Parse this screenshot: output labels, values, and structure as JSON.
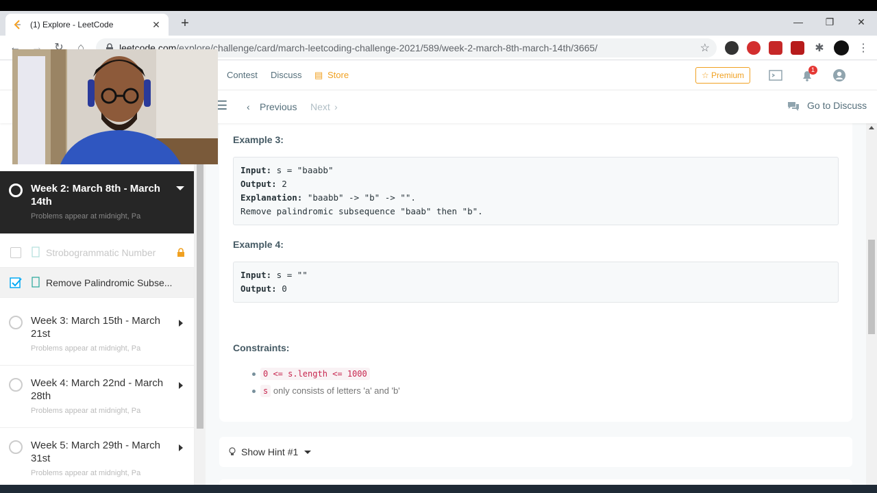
{
  "browser": {
    "tab_title": "(1) Explore - LeetCode",
    "tab_close": "✕",
    "new_tab": "+",
    "url_host": "leetcode.com",
    "url_path": "/explore/challenge/card/march-leetcoding-challenge-2021/589/week-2-march-8th-march-14th/3665/",
    "min": "—",
    "restore": "❐",
    "close": "✕"
  },
  "header": {
    "nav": [
      "Contest",
      "Discuss",
      "Store"
    ],
    "premium": "Premium",
    "notification_count": "1"
  },
  "subbar": {
    "previous": "Previous",
    "next": "Next",
    "discuss": "Go to Discuss"
  },
  "sidebar": {
    "active_week": {
      "title": "Week 2: March 8th - March 14th",
      "subtitle": "Problems appear at midnight, Pa"
    },
    "problems": [
      {
        "label": "Strobogrammatic Number",
        "locked": true,
        "checked": false
      },
      {
        "label": "Remove Palindromic Subse...",
        "locked": false,
        "checked": true
      }
    ],
    "weeks": [
      {
        "title": "Week 3: March 15th - March 21st",
        "subtitle": "Problems appear at midnight, Pa"
      },
      {
        "title": "Week 4: March 22nd - March 28th",
        "subtitle": "Problems appear at midnight, Pa"
      },
      {
        "title": "Week 5: March 29th - March 31st",
        "subtitle": "Problems appear at midnight, Pa"
      }
    ]
  },
  "content": {
    "example3_heading": "Example 3:",
    "example3": {
      "l1_label": "Input:",
      "l1_value": " s = \"baabb\"",
      "l2_label": "Output:",
      "l2_value": " 2",
      "l3_label": "Explanation:",
      "l3_value": " \"baabb\" -> \"b\" -> \"\".",
      "l4": "Remove palindromic subsequence \"baab\" then \"b\"."
    },
    "example4_heading": "Example 4:",
    "example4": {
      "l1_label": "Input:",
      "l1_value": " s = \"\"",
      "l2_label": "Output:",
      "l2_value": " 0"
    },
    "constraints_heading": "Constraints:",
    "constraint1_code": "0 <= s.length <= 1000",
    "constraint2_code": "s",
    "constraint2_text": "only consists of letters 'a' and 'b'",
    "hint_label": "Show Hint #1"
  }
}
